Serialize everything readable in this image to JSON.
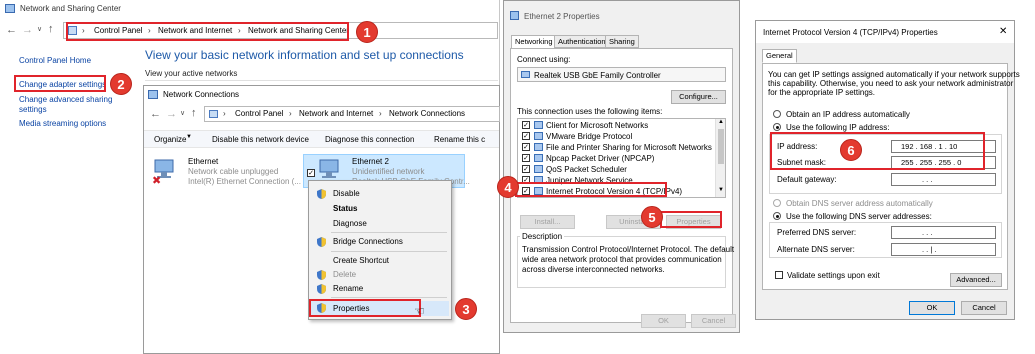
{
  "sharing_center": {
    "title": "Network and Sharing Center",
    "breadcrumb": [
      "Control Panel",
      "Network and Internet",
      "Network and Sharing Center"
    ],
    "sidebar": [
      "Control Panel Home",
      "Change adapter settings",
      "Change advanced sharing",
      "settings",
      "Media streaming options"
    ],
    "heading": "View your basic network information and set up connections",
    "subheading": "View your active networks"
  },
  "network_connections": {
    "title": "Network Connections",
    "breadcrumb": [
      "Control Panel",
      "Network and Internet",
      "Network Connections"
    ],
    "toolbar": [
      "Organize",
      "Disable this network device",
      "Diagnose this connection",
      "Rename this c"
    ],
    "adapters": [
      {
        "name": "Ethernet",
        "status": "Network cable unplugged",
        "device": "Intel(R) Ethernet Connection (..."
      },
      {
        "name": "Ethernet 2",
        "status": "Unidentified network",
        "device": "Realtek USB GbE Family Contr..."
      }
    ],
    "context_menu": [
      "Disable",
      "Status",
      "Diagnose",
      "Bridge Connections",
      "Create Shortcut",
      "Delete",
      "Rename",
      "Properties"
    ]
  },
  "eth_properties": {
    "title": "Ethernet 2 Properties",
    "tabs": [
      "Networking",
      "Authentication",
      "Sharing"
    ],
    "connect_using_label": "Connect using:",
    "device": "Realtek USB GbE Family Controller",
    "configure_button": "Configure...",
    "items_label": "This connection uses the following items:",
    "items": [
      "Client for Microsoft Networks",
      "VMware Bridge Protocol",
      "File and Printer Sharing for Microsoft Networks",
      "Npcap Packet Driver (NPCAP)",
      "QoS Packet Scheduler",
      "Juniper Network Service",
      "Internet Protocol Version 4 (TCP/IPv4)"
    ],
    "install_button": "Install...",
    "uninstall_button": "Uninstall",
    "properties_button": "Properties",
    "description_label": "Description",
    "description": [
      "Transmission Control Protocol/Internet Protocol. The default",
      "wide area network protocol that provides communication",
      "across diverse interconnected networks."
    ],
    "ok_button": "OK",
    "cancel_button": "Cancel"
  },
  "ipv4": {
    "title": "Internet Protocol Version 4 (TCP/IPv4) Properties",
    "tab": "General",
    "intro": [
      "You can get IP settings assigned automatically if your network supports",
      "this capability. Otherwise, you need to ask your network administrator",
      "for the appropriate IP settings."
    ],
    "auto_ip": "Obtain an IP address automatically",
    "manual_ip": "Use the following IP address:",
    "ip_label": "IP address:",
    "ip_value": "192 . 168 . 1 . 10",
    "mask_label": "Subnet mask:",
    "mask_value": "255 . 255 . 255 . 0",
    "gateway_label": "Default gateway:",
    "gateway_value": ".       .       .",
    "auto_dns": "Obtain DNS server address automatically",
    "manual_dns": "Use the following DNS server addresses:",
    "preferred_dns_label": "Preferred DNS server:",
    "preferred_dns_value": ".       .       .",
    "alternate_dns_label": "Alternate DNS server:",
    "alternate_dns_value": ".       .   |   .",
    "validate": "Validate settings upon exit",
    "advanced_button": "Advanced...",
    "ok_button": "OK",
    "cancel_button": "Cancel"
  },
  "step_badges": [
    "1",
    "2",
    "3",
    "4",
    "5",
    "6"
  ],
  "colors": {
    "callout_red": "#e33a2f",
    "link_blue": "#0b44a4",
    "heading_blue": "#1e5aa8",
    "selection": "#cce8ff"
  }
}
